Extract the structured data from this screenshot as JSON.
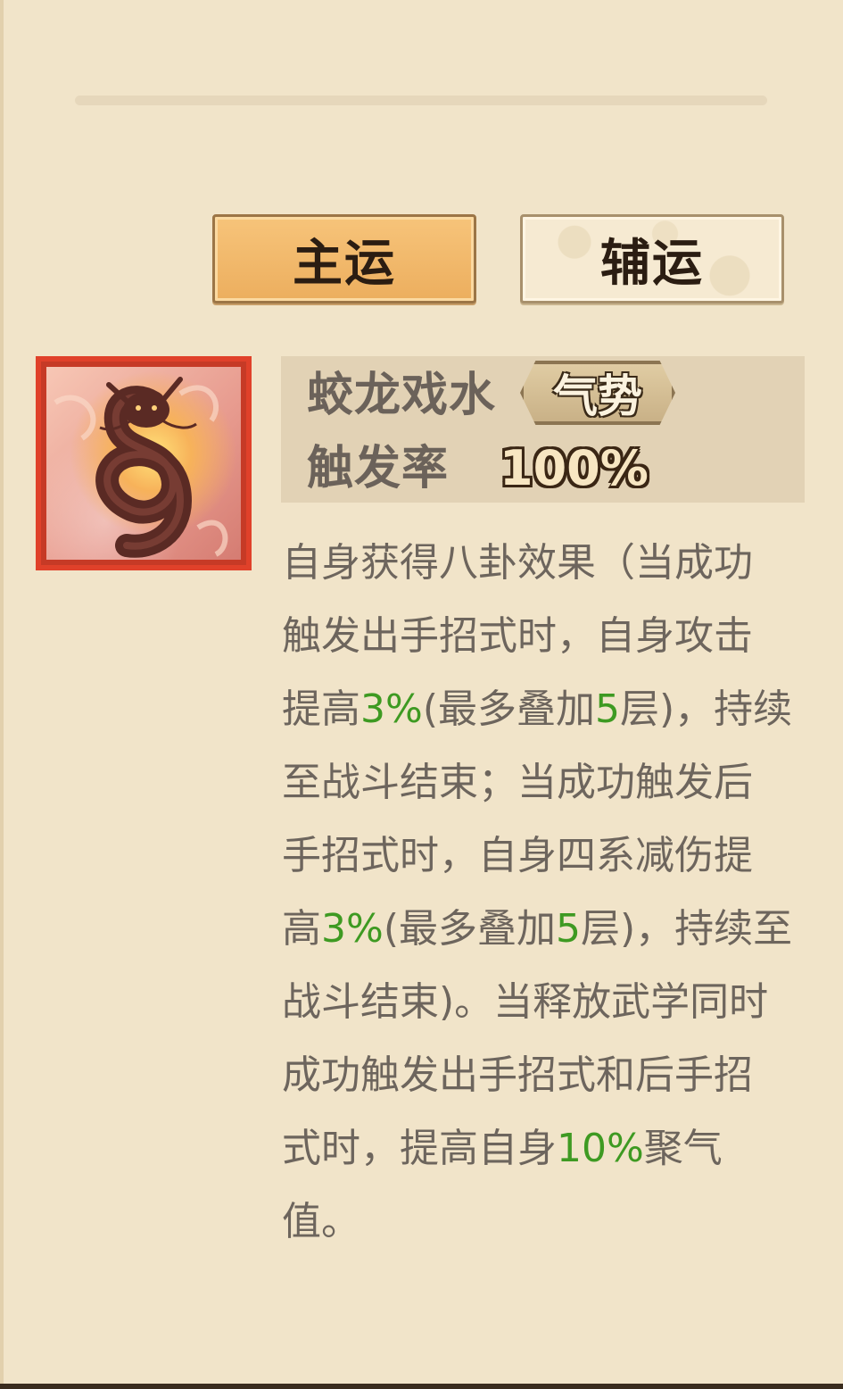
{
  "tabs": {
    "main_label": "主运",
    "sub_label": "辅运"
  },
  "skill": {
    "icon": "coiled-dragon-icon",
    "name": "蛟龙戏水",
    "type_badge": "气势",
    "rate_label": "触发率",
    "rate_value": "100%"
  },
  "description": {
    "lines": [
      [
        {
          "t": "自身获得八卦效果（当成功"
        }
      ],
      [
        {
          "t": "触发出手招式时，自身攻击"
        }
      ],
      [
        {
          "t": "提高"
        },
        {
          "t": "3%",
          "hl": true
        },
        {
          "t": "(最多叠加"
        },
        {
          "t": "5",
          "hl": true
        },
        {
          "t": "层)，持续"
        }
      ],
      [
        {
          "t": "至战斗结束；当成功触发后"
        }
      ],
      [
        {
          "t": "手招式时，自身四系减伤提"
        }
      ],
      [
        {
          "t": "高"
        },
        {
          "t": "3%",
          "hl": true
        },
        {
          "t": "(最多叠加"
        },
        {
          "t": "5",
          "hl": true
        },
        {
          "t": "层)，持续至"
        }
      ],
      [
        {
          "t": "战斗结束)。当释放武学同时"
        }
      ],
      [
        {
          "t": "成功触发出手招式和后手招"
        }
      ],
      [
        {
          "t": "式时，提高自身"
        },
        {
          "t": "10%",
          "hl": true
        },
        {
          "t": "聚气"
        }
      ],
      [
        {
          "t": "值。"
        }
      ]
    ]
  },
  "colors": {
    "highlight": "#3e9a22",
    "text": "#6d655d",
    "background": "#f1e4c9",
    "main_tab": "#f2b868",
    "icon_border": "#e0412a"
  }
}
